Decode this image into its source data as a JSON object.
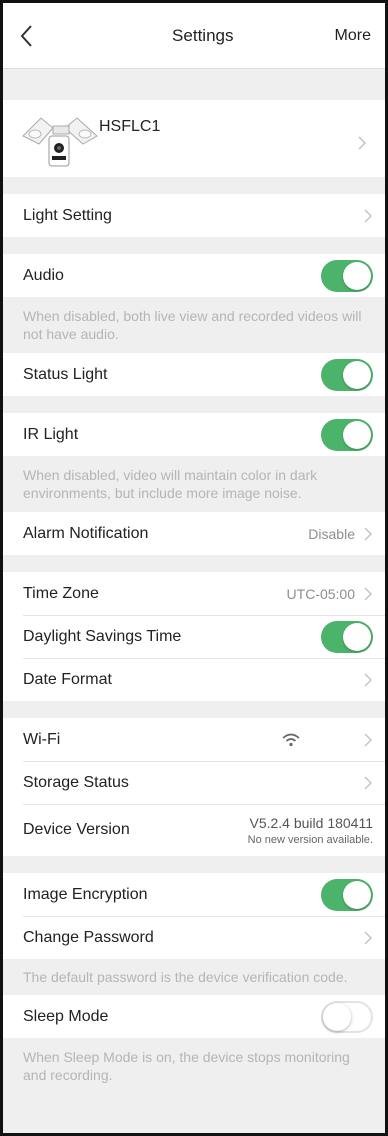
{
  "nav": {
    "back_icon": "chevron-left-icon",
    "title": "Settings",
    "more_label": "More"
  },
  "device": {
    "name": "HSFLC1",
    "image_icon": "floodlight-camera-icon"
  },
  "rows": {
    "light_setting": {
      "label": "Light Setting"
    },
    "audio": {
      "label": "Audio",
      "enabled": true,
      "note": "When disabled, both live view and recorded videos will not have audio."
    },
    "status_light": {
      "label": "Status Light",
      "enabled": true
    },
    "ir_light": {
      "label": "IR Light",
      "enabled": true,
      "note": "When disabled, video will maintain color in dark environments, but include more image noise."
    },
    "alarm_notification": {
      "label": "Alarm Notification",
      "value": "Disable"
    },
    "time_zone": {
      "label": "Time Zone",
      "value": "UTC-05:00"
    },
    "daylight_savings": {
      "label": "Daylight Savings Time",
      "enabled": true
    },
    "date_format": {
      "label": "Date Format"
    },
    "wifi": {
      "label": "Wi-Fi",
      "icon": "wifi-icon"
    },
    "storage_status": {
      "label": "Storage Status"
    },
    "device_version": {
      "label": "Device Version",
      "version": "V5.2.4 build 180411",
      "status": "No new version available."
    },
    "image_encryption": {
      "label": "Image Encryption",
      "enabled": true
    },
    "change_password": {
      "label": "Change Password",
      "note": "The default password is the device verification code."
    },
    "sleep_mode": {
      "label": "Sleep Mode",
      "enabled": false,
      "note": "When Sleep Mode is on, the device stops monitoring and recording."
    }
  },
  "colors": {
    "toggle_on": "#4cb36a",
    "background": "#efeff0",
    "note_text": "#b5b5b5"
  }
}
